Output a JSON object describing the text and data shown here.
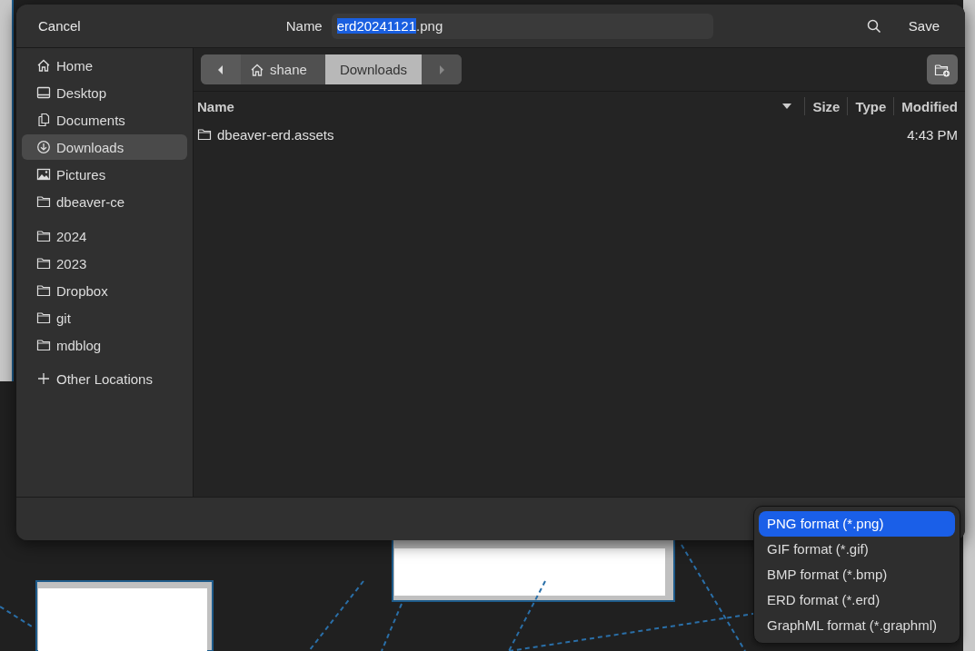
{
  "header": {
    "cancel": "Cancel",
    "name_label": "Name",
    "name_value_selected": "erd20241121",
    "name_value_rest": ".png",
    "save": "Save"
  },
  "sidebar": {
    "places": [
      {
        "label": "Home",
        "kind": "home",
        "selected": false
      },
      {
        "label": "Desktop",
        "kind": "desktop",
        "selected": false
      },
      {
        "label": "Documents",
        "kind": "documents",
        "selected": false
      },
      {
        "label": "Downloads",
        "kind": "downloads",
        "selected": true
      },
      {
        "label": "Pictures",
        "kind": "pictures",
        "selected": false
      },
      {
        "label": "dbeaver-ce",
        "kind": "folder",
        "selected": false
      }
    ],
    "bookmarks": [
      {
        "label": "2024",
        "kind": "folder",
        "selected": false
      },
      {
        "label": "2023",
        "kind": "folder",
        "selected": false
      },
      {
        "label": "Dropbox",
        "kind": "folder",
        "selected": false
      },
      {
        "label": "git",
        "kind": "folder",
        "selected": false
      },
      {
        "label": "mdblog",
        "kind": "folder",
        "selected": false
      }
    ],
    "other": {
      "label": "Other Locations"
    }
  },
  "path_bar": {
    "crumbs": [
      {
        "label": "shane",
        "kind": "home",
        "selected": false
      },
      {
        "label": "Downloads",
        "kind": "folder",
        "selected": true
      }
    ]
  },
  "file_list": {
    "columns": [
      "Name",
      "Size",
      "Type",
      "Modified"
    ],
    "rows": [
      {
        "name": "dbeaver-erd.assets",
        "modified": "4:43 PM"
      }
    ]
  },
  "format_menu": {
    "items": [
      {
        "label": "PNG format (*.png)",
        "selected": true
      },
      {
        "label": "GIF format (*.gif)",
        "selected": false
      },
      {
        "label": "BMP format (*.bmp)",
        "selected": false
      },
      {
        "label": "ERD format (*.erd)",
        "selected": false
      },
      {
        "label": "GraphML format (*.graphml)",
        "selected": false
      }
    ]
  }
}
